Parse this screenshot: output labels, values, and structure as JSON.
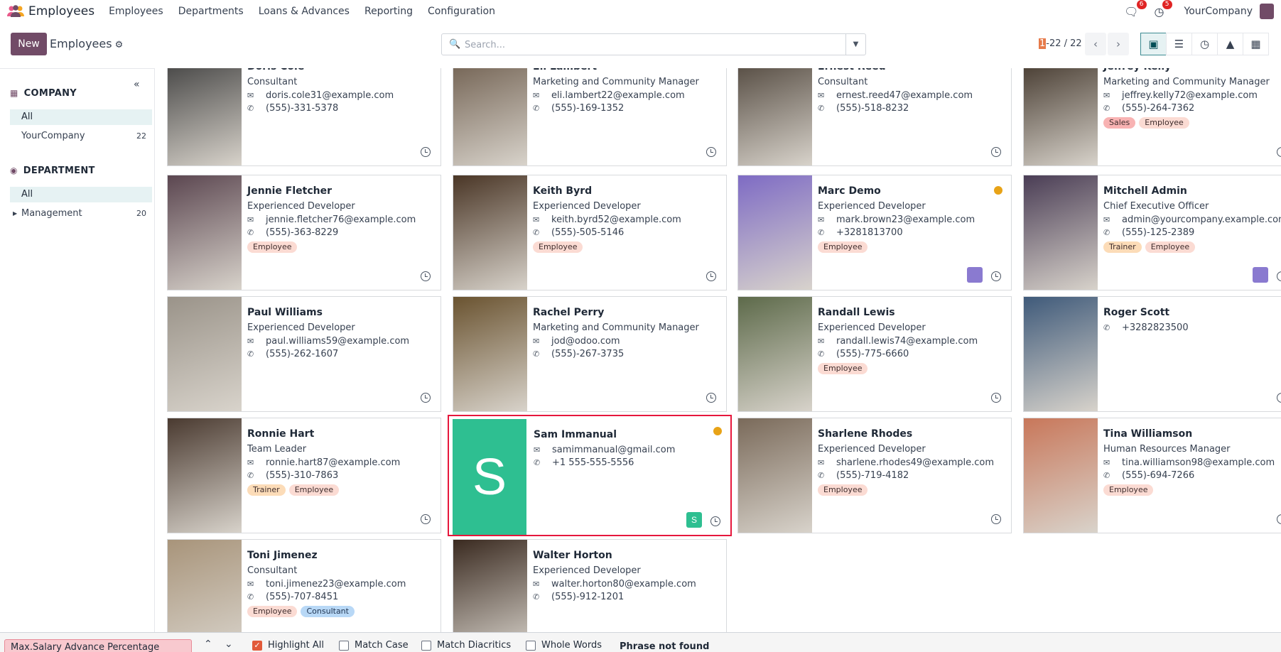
{
  "navbar": {
    "app_name": "Employees",
    "menu": [
      "Employees",
      "Departments",
      "Loans & Advances",
      "Reporting",
      "Configuration"
    ],
    "messages_count": "6",
    "activities_count": "5",
    "company": "YourCompany"
  },
  "control": {
    "new_label": "New",
    "breadcrumb": "Employees",
    "search_placeholder": "Search...",
    "pager_current": "1",
    "pager_rest": "-22 / 22"
  },
  "sidebar": {
    "company_heading": "COMPANY",
    "company_items": [
      {
        "label": "All"
      },
      {
        "label": "YourCompany",
        "count": "22"
      }
    ],
    "department_heading": "DEPARTMENT",
    "department_items": [
      {
        "label": "All"
      },
      {
        "label": "Management",
        "count": "20"
      }
    ]
  },
  "employees": [
    {
      "name": "Doris Cole",
      "job": "Consultant",
      "email": "doris.cole31@example.com",
      "phone": "(555)-331-5378",
      "tags": []
    },
    {
      "name": "Eli Lambert",
      "job": "Marketing and Community Manager",
      "email": "eli.lambert22@example.com",
      "phone": "(555)-169-1352",
      "tags": []
    },
    {
      "name": "Ernest Reed",
      "job": "Consultant",
      "email": "ernest.reed47@example.com",
      "phone": "(555)-518-8232",
      "tags": []
    },
    {
      "name": "Jeffrey Kelly",
      "job": "Marketing and Community Manager",
      "email": "jeffrey.kelly72@example.com",
      "phone": "(555)-264-7362",
      "tags": [
        "Sales",
        "Employee"
      ]
    },
    {
      "name": "Jennie Fletcher",
      "job": "Experienced Developer",
      "email": "jennie.fletcher76@example.com",
      "phone": "(555)-363-8229",
      "tags": [
        "Employee"
      ]
    },
    {
      "name": "Keith Byrd",
      "job": "Experienced Developer",
      "email": "keith.byrd52@example.com",
      "phone": "(555)-505-5146",
      "tags": [
        "Employee"
      ]
    },
    {
      "name": "Marc Demo",
      "job": "Experienced Developer",
      "email": "mark.brown23@example.com",
      "phone": "+3281813700",
      "tags": [
        "Employee"
      ]
    },
    {
      "name": "Mitchell Admin",
      "job": "Chief Executive Officer",
      "email": "admin@yourcompany.example.com",
      "phone": "(555)-125-2389",
      "tags": [
        "Trainer",
        "Employee"
      ]
    },
    {
      "name": "Paul Williams",
      "job": "Experienced Developer",
      "email": "paul.williams59@example.com",
      "phone": "(555)-262-1607",
      "tags": []
    },
    {
      "name": "Rachel Perry",
      "job": "Marketing and Community Manager",
      "email": "jod@odoo.com",
      "phone": "(555)-267-3735",
      "tags": []
    },
    {
      "name": "Randall Lewis",
      "job": "Experienced Developer",
      "email": "randall.lewis74@example.com",
      "phone": "(555)-775-6660",
      "tags": [
        "Employee"
      ]
    },
    {
      "name": "Roger Scott",
      "job": "",
      "email": "",
      "phone": "+3282823500",
      "tags": []
    },
    {
      "name": "Ronnie Hart",
      "job": "Team Leader",
      "email": "ronnie.hart87@example.com",
      "phone": "(555)-310-7863",
      "tags": [
        "Trainer",
        "Employee"
      ]
    },
    {
      "name": "Sam Immanual",
      "job": "",
      "email": "samimmanual@gmail.com",
      "phone": "+1 555-555-5556",
      "tags": [],
      "initial": "S"
    },
    {
      "name": "Sharlene Rhodes",
      "job": "Experienced Developer",
      "email": "sharlene.rhodes49@example.com",
      "phone": "(555)-719-4182",
      "tags": [
        "Employee"
      ]
    },
    {
      "name": "Tina Williamson",
      "job": "Human Resources Manager",
      "email": "tina.williamson98@example.com",
      "phone": "(555)-694-7266",
      "tags": [
        "Employee"
      ]
    },
    {
      "name": "Toni Jimenez",
      "job": "Consultant",
      "email": "toni.jimenez23@example.com",
      "phone": "(555)-707-8451",
      "tags": [
        "Employee",
        "Consultant"
      ]
    },
    {
      "name": "Walter Horton",
      "job": "Experienced Developer",
      "email": "walter.horton80@example.com",
      "phone": "(555)-912-1201",
      "tags": []
    }
  ],
  "findbar": {
    "query": "Max.Salary Advance Percentage",
    "highlight_all": "Highlight All",
    "match_case": "Match Case",
    "match_diacritics": "Match Diacritics",
    "whole_words": "Whole Words",
    "status": "Phrase not found"
  },
  "colors": {
    "brand": "#714b67",
    "active_view": "#e6f2f3",
    "selection": "#e6173c",
    "avatar_green": "#2ebf91"
  }
}
